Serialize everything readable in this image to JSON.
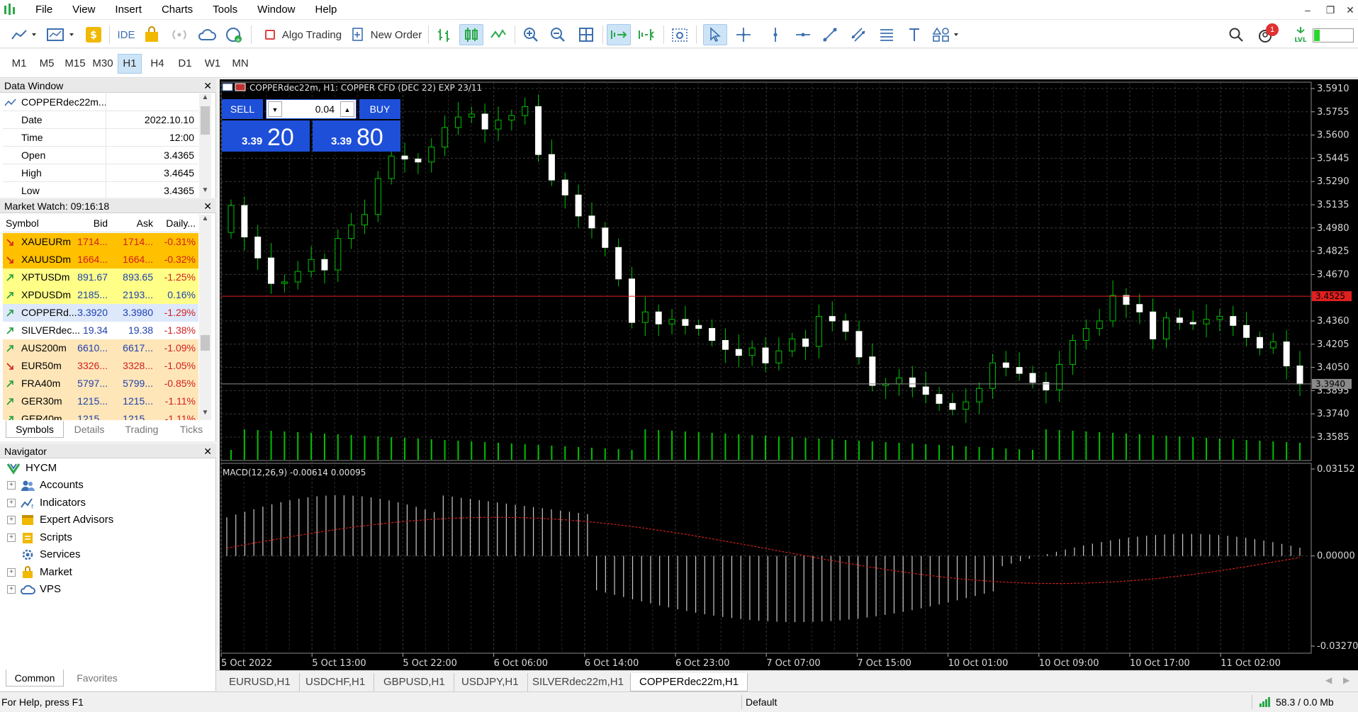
{
  "menu": [
    "File",
    "View",
    "Insert",
    "Charts",
    "Tools",
    "Window",
    "Help"
  ],
  "toolbar": {
    "ide_label": "IDE",
    "algo_trading_label": "Algo Trading",
    "new_order_label": "New Order",
    "notification_count": "1"
  },
  "periods": [
    "M1",
    "M5",
    "M15",
    "M30",
    "H1",
    "H4",
    "D1",
    "W1",
    "MN"
  ],
  "active_period": "H1",
  "data_window": {
    "title": "Data Window",
    "symbol": "COPPERdec22m...",
    "rows": [
      {
        "label": "Date",
        "value": "2022.10.10"
      },
      {
        "label": "Time",
        "value": "12:00"
      },
      {
        "label": "Open",
        "value": "3.4365"
      },
      {
        "label": "High",
        "value": "3.4645"
      },
      {
        "label": "Low",
        "value": "3.4365"
      }
    ]
  },
  "market_watch": {
    "title": "Market Watch: 09:16:18",
    "headers": [
      "Symbol",
      "Bid",
      "Ask",
      "Daily..."
    ],
    "rows": [
      {
        "symbol": "XAUEURm",
        "bid": "1714...",
        "ask": "1714...",
        "daily": "-0.31%",
        "dir": "down",
        "bg": "#ffc000"
      },
      {
        "symbol": "XAUUSDm",
        "bid": "1664...",
        "ask": "1664...",
        "daily": "-0.32%",
        "dir": "down",
        "bg": "#ffc000"
      },
      {
        "symbol": "XPTUSDm",
        "bid": "891.67",
        "ask": "893.65",
        "daily": "-1.25%",
        "dir": "up",
        "bg": "#ffff88"
      },
      {
        "symbol": "XPDUSDm",
        "bid": "2185...",
        "ask": "2193...",
        "daily": "0.16%",
        "dir": "up",
        "bg": "#ffff88"
      },
      {
        "symbol": "COPPERd...",
        "bid": "3.3920",
        "ask": "3.3980",
        "daily": "-1.29%",
        "dir": "up",
        "bg": "#dde8fb"
      },
      {
        "symbol": "SILVERdec...",
        "bid": "19.34",
        "ask": "19.38",
        "daily": "-1.38%",
        "dir": "up",
        "bg": "#ffffff"
      },
      {
        "symbol": "AUS200m",
        "bid": "6610...",
        "ask": "6617...",
        "daily": "-1.09%",
        "dir": "up",
        "bg": "#ffe6b8"
      },
      {
        "symbol": "EUR50m",
        "bid": "3326...",
        "ask": "3328...",
        "daily": "-1.05%",
        "dir": "down",
        "bg": "#ffe6b8"
      },
      {
        "symbol": "FRA40m",
        "bid": "5797...",
        "ask": "5799...",
        "daily": "-0.85%",
        "dir": "up",
        "bg": "#ffe6b8"
      },
      {
        "symbol": "GER30m",
        "bid": "1215...",
        "ask": "1215...",
        "daily": "-1.11%",
        "dir": "up",
        "bg": "#ffe6b8"
      },
      {
        "symbol": "GER40m",
        "bid": "1215...",
        "ask": "1215...",
        "daily": "-1.11%",
        "dir": "up",
        "bg": "#ffe6b8"
      }
    ],
    "tabs": [
      "Symbols",
      "Details",
      "Trading",
      "Ticks"
    ]
  },
  "navigator": {
    "title": "Navigator",
    "root": "HYCM",
    "items": [
      "Accounts",
      "Indicators",
      "Expert Advisors",
      "Scripts",
      "Services",
      "Market",
      "VPS"
    ],
    "tabs": [
      "Common",
      "Favorites"
    ]
  },
  "chart": {
    "header": "COPPERdec22m, H1:  COPPER CFD (DEC 22) EXP 23/11",
    "sell_label": "SELL",
    "buy_label": "BUY",
    "volume": "0.04",
    "sell_price_small": "3.39",
    "sell_price_big": "20",
    "buy_price_small": "3.39",
    "buy_price_big": "80",
    "price_ticks": [
      "3.5910",
      "3.5755",
      "3.5600",
      "3.5445",
      "3.5290",
      "3.5135",
      "3.4980",
      "3.4825",
      "3.4670",
      "3.4360",
      "3.4205",
      "3.4050",
      "3.3895",
      "3.3740",
      "3.3585"
    ],
    "red_line_label": "3.4525",
    "bid_label": "3.3940",
    "macd_label": "MACD(12,26,9) -0.00614 0.00095",
    "macd_ticks": [
      "0.03152",
      "0.00000",
      "-0.03270"
    ],
    "time_ticks": [
      "5 Oct 2022",
      "5 Oct 13:00",
      "5 Oct 22:00",
      "6 Oct 06:00",
      "6 Oct 14:00",
      "6 Oct 23:00",
      "7 Oct 07:00",
      "7 Oct 15:00",
      "10 Oct 01:00",
      "10 Oct 09:00",
      "10 Oct 17:00",
      "11 Oct 02:00"
    ]
  },
  "chart_tabs": [
    "EURUSD,H1",
    "USDCHF,H1",
    "GBPUSD,H1",
    "USDJPY,H1",
    "SILVERdec22m,H1",
    "COPPERdec22m,H1"
  ],
  "active_chart_tab": "COPPERdec22m,H1",
  "status": {
    "help": "For Help, press F1",
    "profile": "Default",
    "connection": "58.3 / 0.0 Mb"
  },
  "colors": {
    "chart_bg": "#000000",
    "candle_up": "#00c000",
    "candle_body_down": "#ffffff",
    "volume": "#00c000",
    "grid": "#3a3a3a",
    "one_click_blue": "#1e4fd8",
    "highlight": "#cde4f7"
  }
}
